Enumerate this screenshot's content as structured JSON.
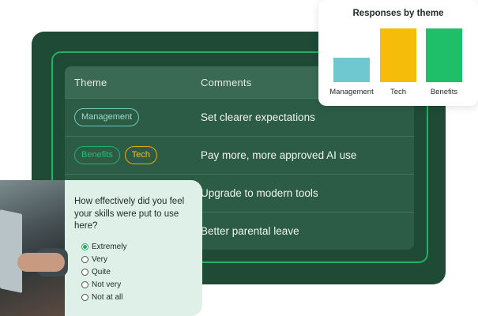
{
  "table": {
    "headers": {
      "theme": "Theme",
      "comments": "Comments"
    },
    "rows": [
      {
        "tags": [
          {
            "label": "Management",
            "kind": "management"
          }
        ],
        "comment": "Set clearer expectations"
      },
      {
        "tags": [
          {
            "label": "Benefits",
            "kind": "benefits"
          },
          {
            "label": "Tech",
            "kind": "tech"
          }
        ],
        "comment": "Pay more, more approved AI use"
      },
      {
        "tags": [],
        "comment": "Upgrade to modern tools"
      },
      {
        "tags": [],
        "comment": "Better parental leave"
      }
    ]
  },
  "chart_data": {
    "type": "bar",
    "title": "Responses by theme",
    "categories": [
      "Management",
      "Tech",
      "Benefits"
    ],
    "values": [
      30,
      66,
      66
    ],
    "colors": [
      "#6fc8cf",
      "#f5bd0a",
      "#1fbf6a"
    ],
    "ylim": [
      0,
      66
    ],
    "grid": false,
    "xlabel": "",
    "ylabel": ""
  },
  "survey": {
    "question": "How effectively did you feel your skills were put to use here?",
    "options": [
      "Extremely",
      "Very",
      "Quite",
      "Not very",
      "Not at all"
    ],
    "selected": "Extremely"
  },
  "colors": {
    "card_bg": "#1f4a36",
    "frame_accent": "#1fb361",
    "management": "#6fc8be",
    "benefits": "#1fb361",
    "tech": "#e2ae08"
  }
}
